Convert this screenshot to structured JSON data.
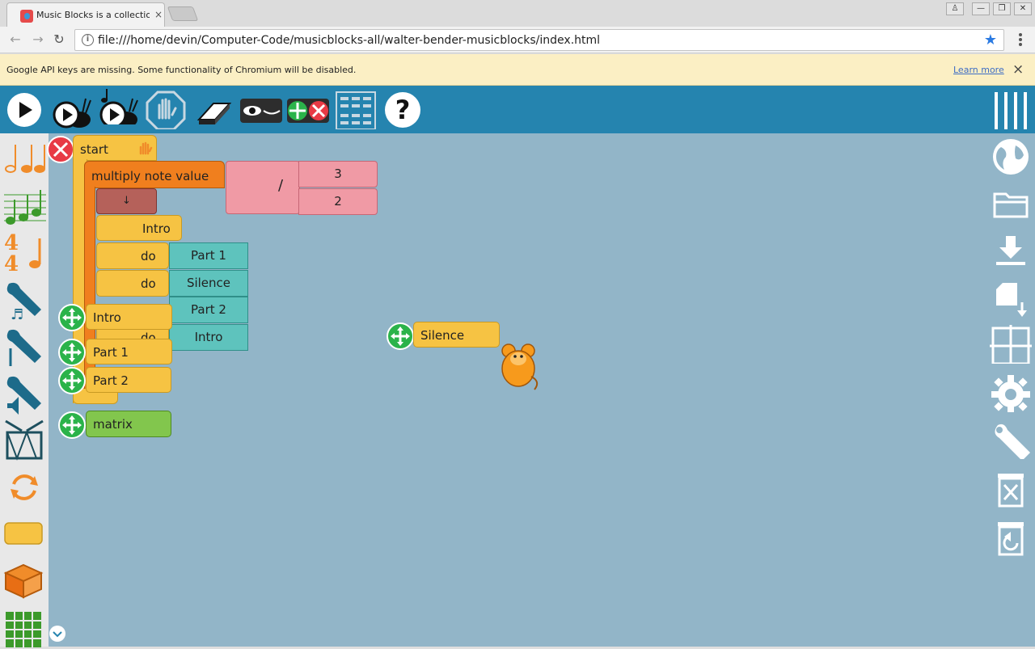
{
  "browser": {
    "tab_title": "Music Blocks is a collection",
    "tab_close": "×",
    "url": "file:///home/devin/Computer-Code/musicblocks-all/walter-bender-musicblocks/index.html",
    "infobar_text": "Google API keys are missing. Some functionality of Chromium will be disabled.",
    "learn_more": "Learn more",
    "close_glyph": "×",
    "back": "←",
    "forward": "→",
    "reload": "↻",
    "star": "★",
    "win_min": "—",
    "win_max": "❐",
    "win_close": "✕",
    "user": "♙"
  },
  "toolbar_icons": [
    "play-icon",
    "run-slow-icon",
    "run-step-icon",
    "stop-icon",
    "clear-icon",
    "show-hide-blocks-icon",
    "collapse-expand-icon",
    "grid-menu-icon",
    "help-icon"
  ],
  "palette_icons": [
    "rhythm-icon",
    "pitch-icon",
    "meter-icon",
    "tone-icon",
    "ornament-icon",
    "volume-icon",
    "drum-icon",
    "flow-icon",
    "action-icon",
    "boxes-icon",
    "widgets-icon"
  ],
  "right_icons": [
    "menu-icon",
    "language-icon",
    "open-icon",
    "save-icon",
    "paste-icon",
    "grid-icon",
    "settings-icon",
    "tools-icon",
    "trash-icon",
    "restore-icon"
  ],
  "blocks": {
    "start": "start",
    "multiply": "multiply note value",
    "divide": "/",
    "numerator": "3",
    "denominator": "2",
    "arrow": "↓",
    "intro_action": "Intro",
    "do1": "do",
    "do2": "do",
    "do3": "do",
    "part1_arg": "Part 1",
    "silence_arg": "Silence",
    "part2_arg": "Part 2",
    "intro_arg": "Intro",
    "intro_block": "Intro",
    "part1_block": "Part 1",
    "part2_block": "Part 2",
    "matrix_block": "matrix",
    "silence_block": "Silence"
  },
  "colors": {
    "app_toolbar": "#2584af",
    "canvas": "#92b5c8",
    "flow_yellow": "#f6c343",
    "math_pink": "#f09aa5",
    "action_orange": "#f07f1e",
    "text_teal": "#5ec3bd",
    "widget_green": "#82c64d"
  }
}
